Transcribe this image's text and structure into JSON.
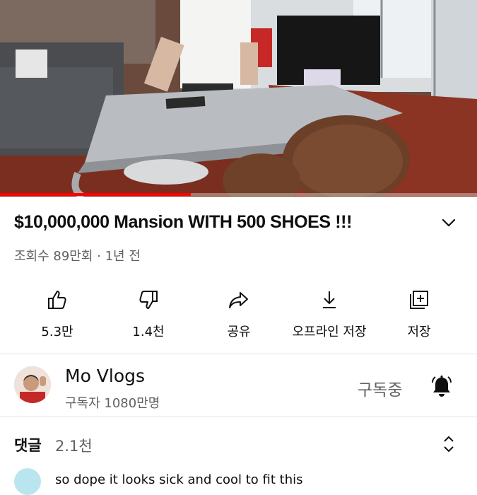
{
  "video": {
    "progress_fraction": 0.4
  },
  "video_info": {
    "title": "$10,000,000 Mansion WITH 500 SHOES !!!",
    "meta": "조회수 89만회 · 1년 전"
  },
  "actions": [
    {
      "label": "5.3만",
      "icon": "thumbs-up-icon"
    },
    {
      "label": "1.4천",
      "icon": "thumbs-down-icon"
    },
    {
      "label": "공유",
      "icon": "share-icon"
    },
    {
      "label": "오프라인 저장",
      "icon": "download-icon"
    },
    {
      "label": "저장",
      "icon": "add-to-playlist-icon"
    }
  ],
  "channel": {
    "name": "Mo Vlogs",
    "subscribers": "구독자 1080만명",
    "subscribe_state": "구독중",
    "bell_icon": "bell-icon"
  },
  "comments": {
    "header": "댓글",
    "count": "2.1천",
    "preview": "so dope it looks sick and cool to fit this"
  },
  "colors": {
    "progress": "#ff0000",
    "secondary_text": "#606060",
    "divider": "#e5e5e5"
  }
}
